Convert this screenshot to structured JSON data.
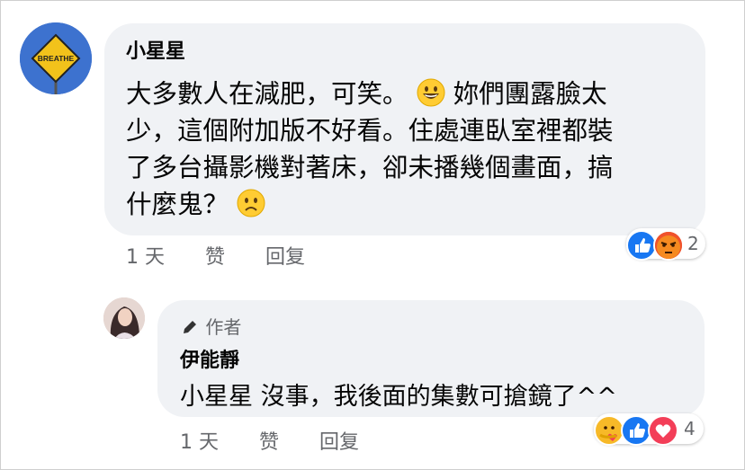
{
  "comment1": {
    "author": "小星星",
    "text_line1": "大多數人在減肥，可笑。",
    "text_line1b": "妳們團露臉太",
    "text_line2": "少，這個附加版不好看。住處連臥室裡都裝",
    "text_line3": "了多台攝影機對著床，卻未播幾個畫面，搞",
    "text_line4": "什麼鬼？",
    "avatar_text": "BREATHE",
    "time": "1 天",
    "like_label": "赞",
    "reply_label": "回复",
    "reaction_count": "2",
    "reactions": [
      "like-icon",
      "angry-icon"
    ]
  },
  "reply1": {
    "author_tag": "作者",
    "author": "伊能靜",
    "mention": "小星星",
    "text": "沒事，我後面的集數可搶鏡了^^",
    "time": "1 天",
    "like_label": "赞",
    "reply_label": "回复",
    "reaction_count": "4",
    "reactions": [
      "care-icon",
      "like-icon",
      "love-icon"
    ]
  },
  "colors": {
    "bubble": "#f0f2f5",
    "secondary_text": "#65676b",
    "like_blue": "#1877f2",
    "angry_orange": "#f0522c",
    "love_red": "#f33e58"
  }
}
